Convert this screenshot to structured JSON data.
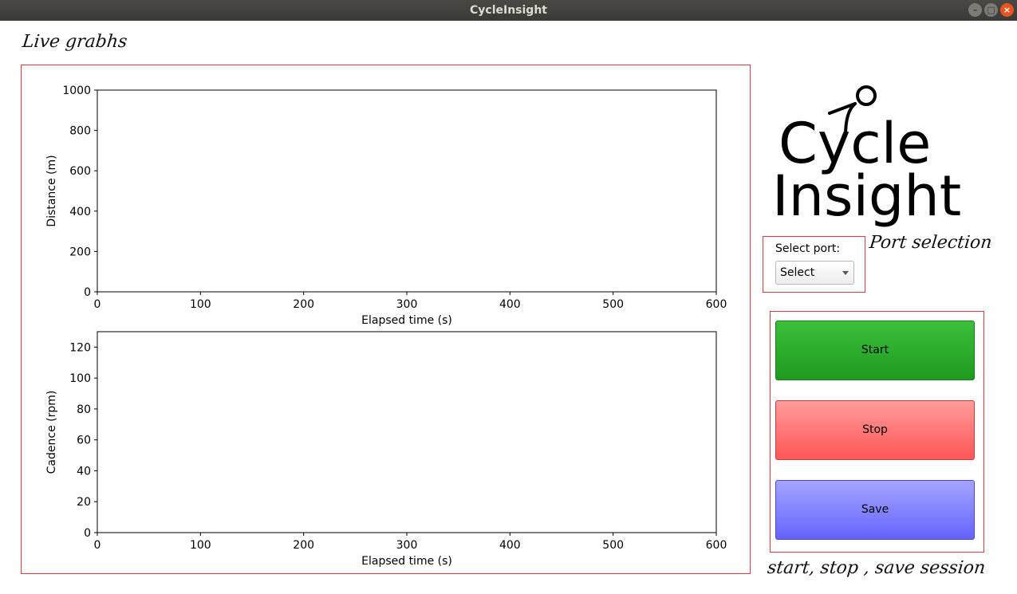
{
  "window": {
    "title": "CycleInsight"
  },
  "annotations": {
    "live_graphs": "Live grabhs",
    "port_selection": "Port selection",
    "session": "start, stop , save session"
  },
  "logo": {
    "line1": "Cycle",
    "line2": "Insight"
  },
  "port": {
    "label": "Select port:",
    "selected": "Select"
  },
  "buttons": {
    "start": "Start",
    "stop": "Stop",
    "save": "Save"
  },
  "colors": {
    "start": "#2eab2e",
    "stop": "#ff7777",
    "save": "#8484ff",
    "annotation_box": "#e23b3b"
  },
  "chart_data": [
    {
      "type": "line",
      "xlabel": "Elapsed time (s)",
      "ylabel": "Distance (m)",
      "xlim": [
        0,
        600
      ],
      "ylim": [
        0,
        1000
      ],
      "xticks": [
        0,
        100,
        200,
        300,
        400,
        500,
        600
      ],
      "yticks": [
        0,
        200,
        400,
        600,
        800,
        1000
      ],
      "series": []
    },
    {
      "type": "line",
      "xlabel": "Elapsed time (s)",
      "ylabel": "Cadence (rpm)",
      "xlim": [
        0,
        600
      ],
      "ylim": [
        0,
        130
      ],
      "xticks": [
        0,
        100,
        200,
        300,
        400,
        500,
        600
      ],
      "yticks": [
        0,
        20,
        40,
        60,
        80,
        100,
        120
      ],
      "series": []
    }
  ]
}
